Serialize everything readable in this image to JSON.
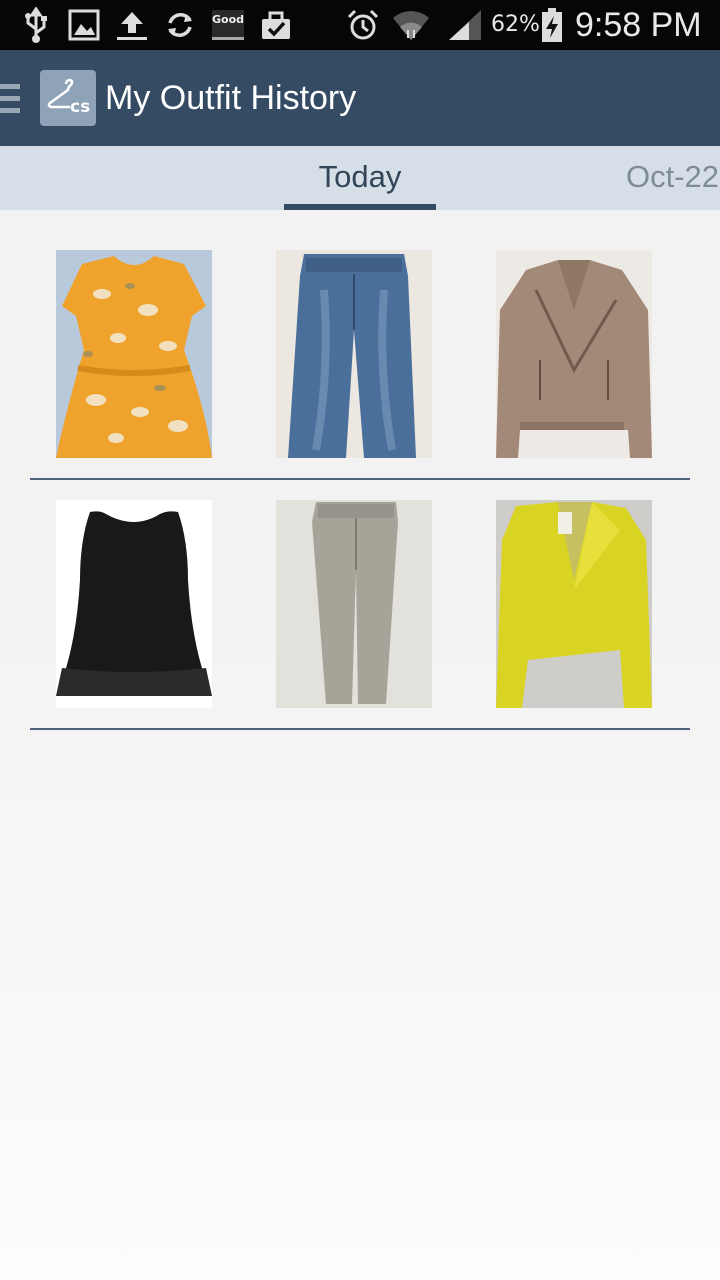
{
  "status_bar": {
    "battery": "62%",
    "time": "9:58 PM",
    "notification_badge": "Good",
    "icons": [
      "usb-icon",
      "image-icon",
      "upload-icon",
      "sync-icon",
      "good-badge-icon",
      "clipboard-check-icon",
      "alarm-icon",
      "wifi-icon",
      "signal-icon",
      "battery-charging-icon"
    ]
  },
  "app_bar": {
    "title": "My Outfit History",
    "logo_text": "cs",
    "menu_icon": "hamburger-menu-icon"
  },
  "tabs": [
    {
      "label": "Today",
      "selected": true
    },
    {
      "label": "Oct-22",
      "selected": false
    }
  ],
  "colors": {
    "app_bar": "#344b63",
    "tab_bar": "#d6dee7",
    "tab_selected_text": "#334659",
    "tab_unselected_text": "#7f8b98",
    "divider": "#4d6278"
  },
  "outfits": [
    {
      "items": [
        "orange-floral-top",
        "blue-flare-jeans",
        "taupe-leather-jacket"
      ]
    },
    {
      "items": [
        "black-sleeveless-top",
        "grey-skinny-pants",
        "yellow-lace-blazer"
      ]
    }
  ]
}
